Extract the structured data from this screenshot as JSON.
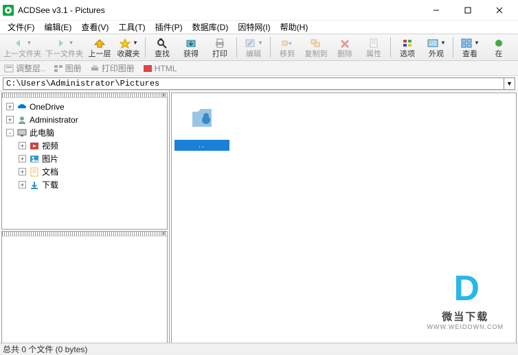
{
  "title": "ACDSee v3.1 - Pictures",
  "menu": [
    "文件(F)",
    "编辑(E)",
    "查看(V)",
    "工具(T)",
    "插件(P)",
    "数据库(D)",
    "因特网(I)",
    "帮助(H)"
  ],
  "toolbar": [
    {
      "label": "上一文件夹",
      "enabled": false,
      "dd": true,
      "icon": "back"
    },
    {
      "label": "下一文件夹",
      "enabled": false,
      "dd": true,
      "icon": "fwd"
    },
    {
      "label": "上一层",
      "enabled": true,
      "icon": "up"
    },
    {
      "label": "收藏夹",
      "enabled": true,
      "dd": true,
      "icon": "fav"
    },
    {
      "sep": true
    },
    {
      "label": "查找",
      "enabled": true,
      "icon": "find"
    },
    {
      "label": "获得",
      "enabled": true,
      "icon": "acquire"
    },
    {
      "label": "打印",
      "enabled": true,
      "icon": "print"
    },
    {
      "sep": true
    },
    {
      "label": "编辑",
      "enabled": false,
      "dd": true,
      "icon": "edit"
    },
    {
      "sep": true
    },
    {
      "label": "移到",
      "enabled": false,
      "icon": "move"
    },
    {
      "label": "复制到",
      "enabled": false,
      "icon": "copy"
    },
    {
      "label": "删除",
      "enabled": false,
      "icon": "delete"
    },
    {
      "label": "属性",
      "enabled": false,
      "icon": "props"
    },
    {
      "sep": true
    },
    {
      "label": "选项",
      "enabled": true,
      "icon": "options"
    },
    {
      "label": "外观",
      "enabled": true,
      "dd": true,
      "icon": "view"
    },
    {
      "sep": true
    },
    {
      "label": "查看",
      "enabled": true,
      "dd": true,
      "icon": "slide"
    },
    {
      "label": "在",
      "enabled": true,
      "icon": "at"
    }
  ],
  "subtoolbar": [
    "调整层..",
    "图册",
    "打印图册",
    "HTML"
  ],
  "path": "C:\\Users\\Administrator\\Pictures",
  "tree": [
    {
      "depth": 1,
      "exp": "+",
      "icon": "onedrive",
      "label": "OneDrive",
      "color": "#0078d4"
    },
    {
      "depth": 1,
      "exp": "+",
      "icon": "user",
      "label": "Administrator",
      "color": "#7a9"
    },
    {
      "depth": 1,
      "exp": "-",
      "icon": "pc",
      "label": "此电脑",
      "color": "#555"
    },
    {
      "depth": 2,
      "exp": "+",
      "icon": "video",
      "label": "视频",
      "color": "#c44"
    },
    {
      "depth": 2,
      "exp": "+",
      "icon": "pics",
      "label": "图片",
      "color": "#39c"
    },
    {
      "depth": 2,
      "exp": "+",
      "icon": "docs",
      "label": "文档",
      "color": "#eb5"
    },
    {
      "depth": 2,
      "exp": "+",
      "icon": "dl",
      "label": "下载",
      "color": "#39c"
    }
  ],
  "thumb_caption": "..",
  "status": "总共 0 个文件 (0 bytes)",
  "watermark": {
    "brand": "微当下载",
    "url": "WWW.WEIDOWN.COM"
  }
}
